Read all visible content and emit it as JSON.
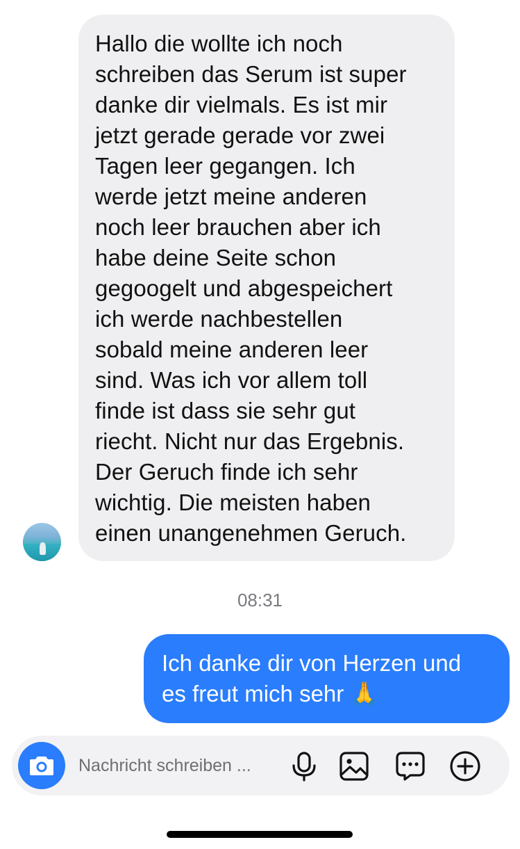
{
  "conversation": {
    "incoming_message": "Hallo die wollte ich noch\nschreiben das Serum ist super\ndanke dir vielmals. Es ist mir\njetzt gerade gerade vor zwei\nTagen leer gegangen. Ich\nwerde jetzt meine anderen\nnoch leer brauchen aber ich\nhabe deine Seite schon\ngegoogelt und abgespeichert\nich werde nachbestellen\nsobald meine anderen leer\nsind. Was ich vor allem toll\nfinde ist dass sie sehr gut\nriecht. Nicht nur das Ergebnis.\nDer Geruch finde ich sehr\nwichtig. Die meisten haben\neinen unangenehmen Geruch.",
    "timestamp": "08:31",
    "outgoing_message": "Ich danke dir von Herzen und\nes freut mich sehr 🙏"
  },
  "composer": {
    "placeholder": "Nachricht schreiben ...",
    "value": "",
    "icons": [
      "camera-icon",
      "microphone-icon",
      "image-icon",
      "sticker-chat-icon",
      "plus-circle-icon"
    ]
  },
  "colors": {
    "accent": "#2a7dfc",
    "incoming_bubble": "#efeff1",
    "composer_bg": "#f2f2f4"
  }
}
